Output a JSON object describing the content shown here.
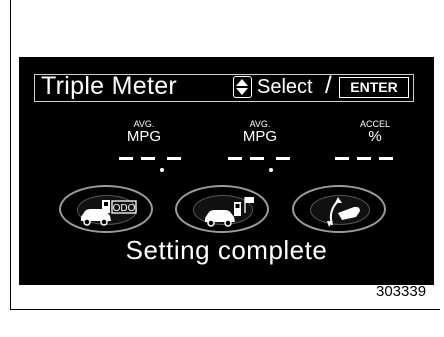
{
  "header": {
    "title": "Triple Meter",
    "select_label": "Select",
    "slash": "/",
    "enter_label": "ENTER",
    "updown_icon": "up-down-arrows-icon"
  },
  "meters": [
    {
      "label_top": "AVG.",
      "label_main": "MPG",
      "value": "--.-"
    },
    {
      "label_top": "AVG.",
      "label_main": "MPG",
      "value": "--.-"
    },
    {
      "label_top": "ACCEL",
      "label_main": "%",
      "value": "---"
    }
  ],
  "buttons": [
    {
      "icon": "car-fuel-odo-icon",
      "text": "ODO"
    },
    {
      "icon": "car-fuel-flag-icon"
    },
    {
      "icon": "accelerator-pedal-icon"
    }
  ],
  "status": "Setting complete",
  "figure_id": "303339",
  "colors": {
    "screen_bg": "#000000",
    "text": "#ffffff",
    "button_border": "#9c9c9c"
  }
}
